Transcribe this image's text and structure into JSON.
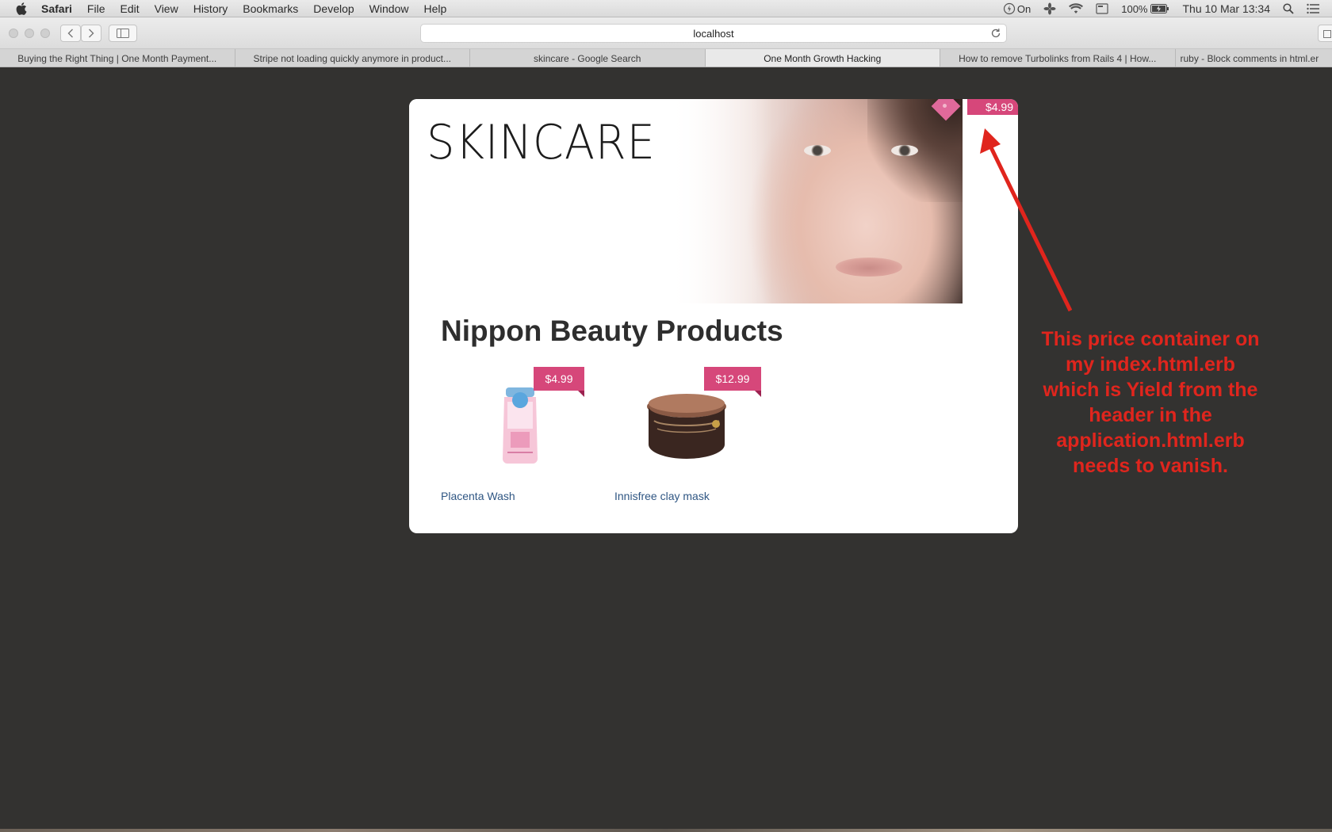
{
  "menubar": {
    "items": [
      "Safari",
      "File",
      "Edit",
      "View",
      "History",
      "Bookmarks",
      "Develop",
      "Window",
      "Help"
    ],
    "status": {
      "power": "On",
      "battery": "100%",
      "datetime": "Thu 10 Mar  13:34"
    }
  },
  "toolbar": {
    "url": "localhost"
  },
  "tabs": [
    {
      "label": "Buying the Right Thing | One Month Payment...",
      "active": false
    },
    {
      "label": "Stripe not loading quickly anymore in product...",
      "active": false
    },
    {
      "label": "skincare - Google Search",
      "active": false
    },
    {
      "label": "One Month Growth Hacking",
      "active": true
    },
    {
      "label": "How to remove Turbolinks from Rails 4 | How...",
      "active": false
    },
    {
      "label": "ruby - Block comments in html.er",
      "active": false
    }
  ],
  "page": {
    "brand": "SKINCARE",
    "header_price": "$4.99",
    "title": "Nippon Beauty Products",
    "products": [
      {
        "name": "Placenta Wash",
        "price": "$4.99"
      },
      {
        "name": "Innisfree clay mask",
        "price": "$12.99"
      }
    ]
  },
  "annotation": {
    "text": "This price container on my index.html.erb which is Yield from the header in the application.html.erb needs to vanish."
  },
  "colors": {
    "price_tag": "#d6477a",
    "annotation": "#e0251d",
    "page_background": "#333230",
    "link": "#2f5683"
  }
}
